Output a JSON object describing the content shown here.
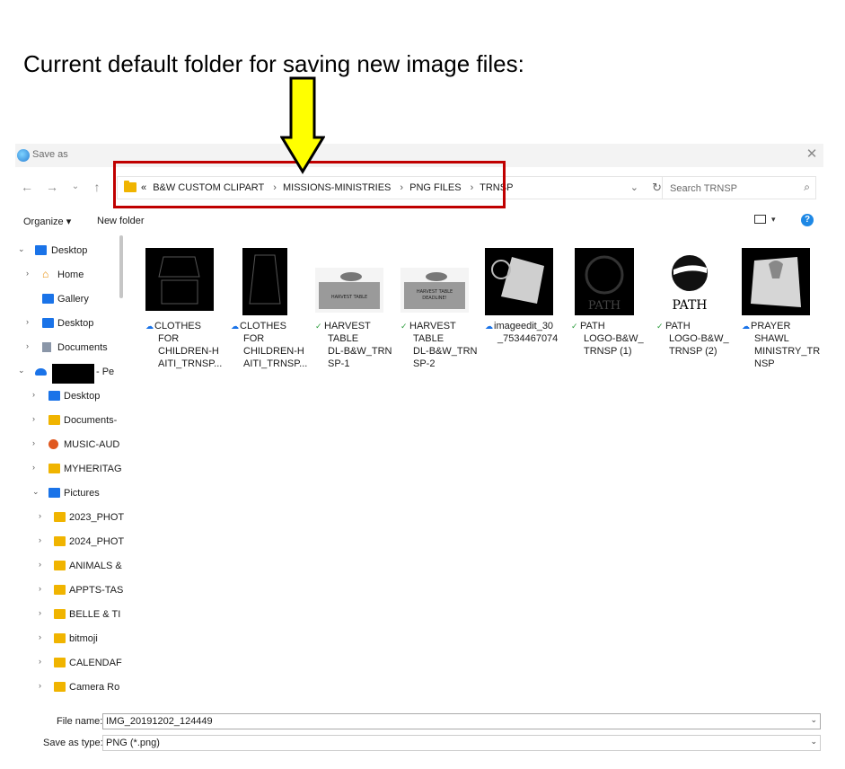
{
  "caption": "Current default folder for saving new image files:",
  "window": {
    "title": "Save as",
    "close": "✕"
  },
  "nav": {
    "back": "←",
    "forward": "→",
    "up_dropdown": "⌄",
    "up": "↑"
  },
  "address": {
    "overflow": "«",
    "crumbs": [
      "B&W CUSTOM CLIPART",
      "MISSIONS-MINISTRIES",
      "PNG FILES",
      "TRNSP"
    ]
  },
  "search": {
    "placeholder": "Search TRNSP"
  },
  "toolbar": {
    "organize": "Organize ▾",
    "new_folder": "New folder"
  },
  "tree": [
    {
      "label": "Desktop",
      "chev": "⌄"
    },
    {
      "label": "Home",
      "chev": "›"
    },
    {
      "label": "Gallery",
      "chev": ""
    },
    {
      "label": "Desktop",
      "chev": "›"
    },
    {
      "label": "Documents",
      "chev": "›"
    },
    {
      "label": "- Pe",
      "chev": "⌄"
    },
    {
      "label": "Desktop",
      "chev": "›"
    },
    {
      "label": "Documents-",
      "chev": "›"
    },
    {
      "label": "MUSIC-AUD",
      "chev": "›"
    },
    {
      "label": "MYHERITAG",
      "chev": "›"
    },
    {
      "label": "Pictures",
      "chev": "⌄"
    },
    {
      "label": "2023_PHOT",
      "chev": "›"
    },
    {
      "label": "2024_PHOT",
      "chev": "›"
    },
    {
      "label": "ANIMALS &",
      "chev": "›"
    },
    {
      "label": "APPTS-TAS",
      "chev": "›"
    },
    {
      "label": "BELLE & TI",
      "chev": "›"
    },
    {
      "label": "bitmoji",
      "chev": "›"
    },
    {
      "label": "CALENDAF",
      "chev": "›"
    },
    {
      "label": "Camera Ro",
      "chev": "›"
    }
  ],
  "files": [
    {
      "status": "☁",
      "name": [
        "CLOTHES",
        "FOR",
        "CHILDREN-H",
        "AITI_TRNSP..."
      ]
    },
    {
      "status": "☁",
      "name": [
        "CLOTHES",
        "FOR",
        "CHILDREN-H",
        "AITI_TRNSP..."
      ]
    },
    {
      "status": "✓",
      "name": [
        "HARVEST",
        "TABLE",
        "DL-B&W_TRN",
        "SP-1"
      ],
      "thumb_text": "HARVEST TABLE"
    },
    {
      "status": "✓",
      "name": [
        "HARVEST",
        "TABLE",
        "DL-B&W_TRN",
        "SP-2"
      ],
      "thumb_text": [
        "HARVEST TABLE",
        "DEADLINE!"
      ]
    },
    {
      "status": "☁",
      "name": [
        "imageedit_30",
        "_7534467074"
      ]
    },
    {
      "status": "✓",
      "name": [
        "PATH",
        "LOGO-B&W_",
        "TRNSP (1)"
      ],
      "thumb_text": "PATH"
    },
    {
      "status": "✓",
      "name": [
        "PATH",
        "LOGO-B&W_",
        "TRNSP (2)"
      ],
      "thumb_text": "PATH"
    },
    {
      "status": "☁",
      "name": [
        "PRAYER",
        "SHAWL",
        "MINISTRY_TR",
        "NSP"
      ]
    }
  ],
  "bottom": {
    "file_name_label": "File name:",
    "file_name_value": "IMG_20191202_124449",
    "save_type_label": "Save as type:",
    "save_type_value": "PNG (*.png)"
  },
  "colors": {
    "highlight_border": "#c00000",
    "arrow_fill": "#ffff00",
    "status_sync": "#2e9e3f",
    "status_cloud": "#1a73e8"
  }
}
